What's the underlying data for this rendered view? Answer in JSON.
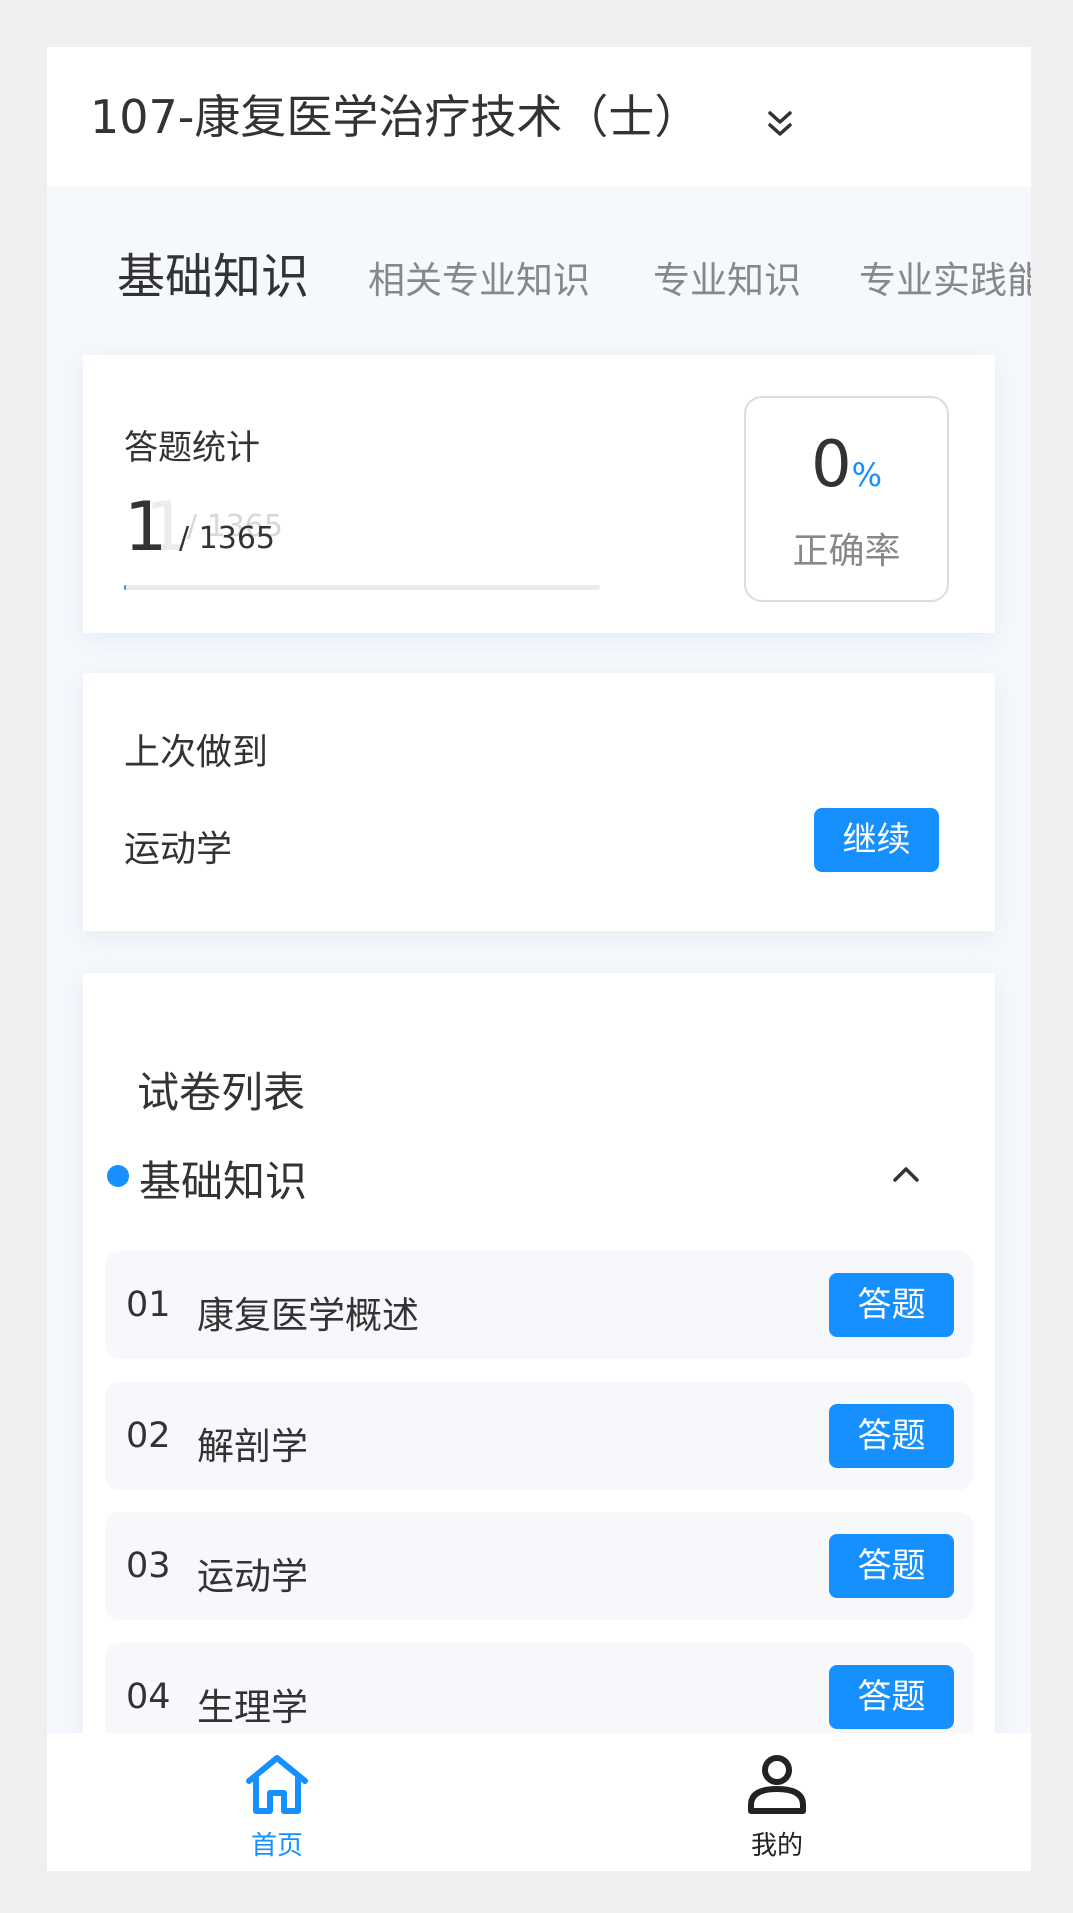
{
  "header": {
    "title": "107-康复医学治疗技术（士）",
    "chevron_icon": "double-chevron-down-icon"
  },
  "tabs": [
    {
      "label": "基础知识",
      "active": true
    },
    {
      "label": "相关专业知识",
      "active": false
    },
    {
      "label": "专业知识",
      "active": false
    },
    {
      "label": "专业实践能",
      "active": false
    }
  ],
  "stats": {
    "label": "答题统计",
    "answered": "1",
    "total": "/ 1365",
    "ghost_count": "1",
    "ghost_total": "/ 1365",
    "progress_fraction": 0.003,
    "accuracy_value": "0",
    "accuracy_unit": "%",
    "accuracy_label": "正确率"
  },
  "last": {
    "label": "上次做到",
    "subject": "运动学",
    "button": "继续"
  },
  "papers": {
    "title": "试卷列表",
    "section": "基础知识",
    "collapse_icon": "chevron-up-icon",
    "items": [
      {
        "num": "01",
        "name": "康复医学概述",
        "button": "答题"
      },
      {
        "num": "02",
        "name": "解剖学",
        "button": "答题"
      },
      {
        "num": "03",
        "name": "运动学",
        "button": "答题"
      },
      {
        "num": "04",
        "name": "生理学",
        "button": "答题"
      }
    ]
  },
  "nav": [
    {
      "label": "首页",
      "icon": "home-icon",
      "active": true
    },
    {
      "label": "我的",
      "icon": "user-icon",
      "active": false
    }
  ],
  "colors": {
    "accent": "#1690ff",
    "nav_inactive": "#222222"
  }
}
